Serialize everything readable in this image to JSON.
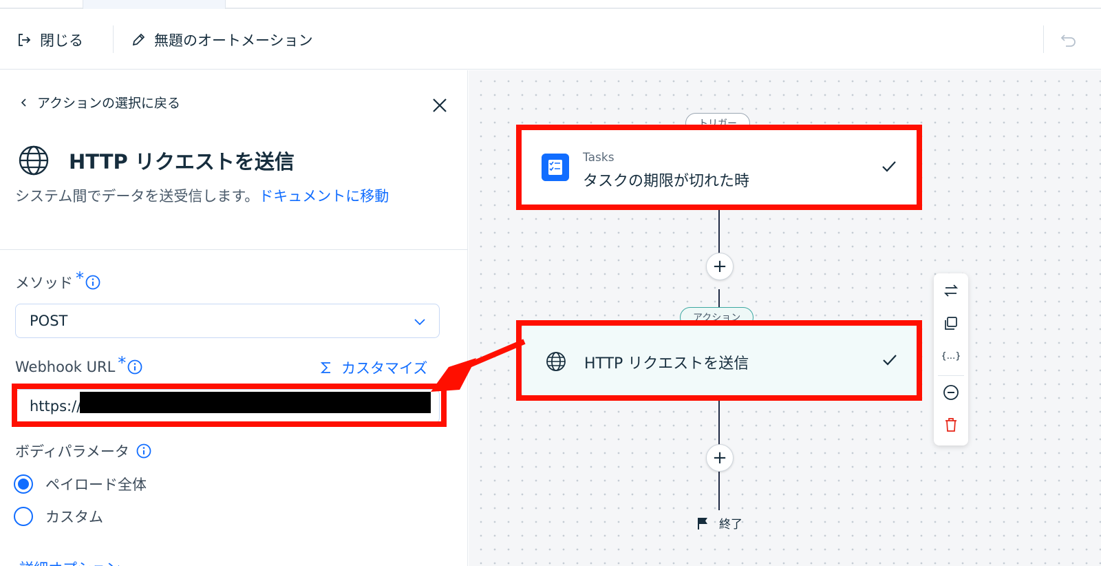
{
  "header": {
    "close_label": "閉じる",
    "automation_title": "無題のオートメーション"
  },
  "panel": {
    "back_label": "アクションの選択に戻る",
    "action_title": "HTTP リクエストを送信",
    "description": "システム間でデータを送受信します。",
    "doc_link": "ドキュメントに移動",
    "method": {
      "label": "メソッド",
      "required_mark": "*",
      "value": "POST"
    },
    "webhook": {
      "label": "Webhook URL",
      "required_mark": "*",
      "customize_label": "カスタマイズ",
      "value": "https://"
    },
    "body_params": {
      "label": "ボディパラメータ",
      "options": [
        {
          "label": "ペイロード全体",
          "selected": true
        },
        {
          "label": "カスタム",
          "selected": false
        }
      ]
    },
    "more_link": "詳細オプション"
  },
  "canvas": {
    "trigger_pill": "トリガー",
    "trigger_node": {
      "app": "Tasks",
      "title": "タスクの期限が切れた時"
    },
    "action_pill": "アクション",
    "action_node": {
      "title": "HTTP リクエストを送信"
    },
    "end_label": "終了"
  },
  "toolbar": {
    "icons": [
      "swap-icon",
      "duplicate-icon",
      "variables-icon",
      "disable-icon",
      "delete-icon"
    ]
  },
  "colors": {
    "accent": "#116dff",
    "highlight": "#ff0f00",
    "danger": "#e62214",
    "action_teal": "#3aa7a0"
  }
}
